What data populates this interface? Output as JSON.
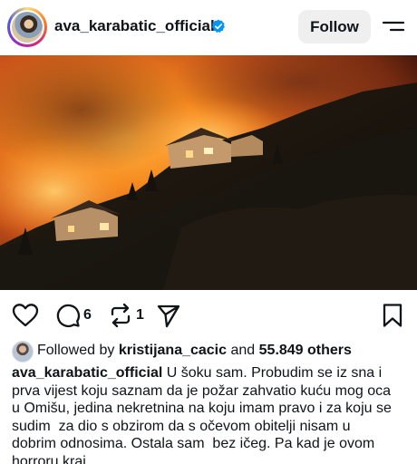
{
  "header": {
    "username": "ava_karabatic_official",
    "follow_label": "Follow",
    "verified_icon": "verified-badge-icon",
    "menu_icon": "menu-icon"
  },
  "post": {
    "image_icon": "wildfire-photo"
  },
  "actions": {
    "like_icon": "heart-icon",
    "comment_icon": "comment-icon",
    "comment_count": "6",
    "repost_icon": "repost-icon",
    "repost_count": "1",
    "share_icon": "send-icon",
    "save_icon": "bookmark-icon"
  },
  "followed_by": {
    "prefix": "Followed by",
    "user": "kristijana_cacic",
    "and": "and",
    "others": "55.849 others"
  },
  "caption": {
    "username": "ava_karabatic_official",
    "lines": [
      " U šoku sam. Probudim se iz sna i",
      "prva vijest koju saznam da je požar zahvatio kuću mog oca",
      "u Omišu, jedina nekretnina na koju imam pravo i za koju se",
      "sudim  za dio s obzirom da s očevom obitelji nisam u",
      "dobrim odnosima. Ostala sam  bez ičeg. Pa kad je ovom",
      "horroru kraj."
    ]
  },
  "colors": {
    "text": "#0f1419",
    "follow_bg": "#efefef",
    "verified": "#0095f6"
  }
}
